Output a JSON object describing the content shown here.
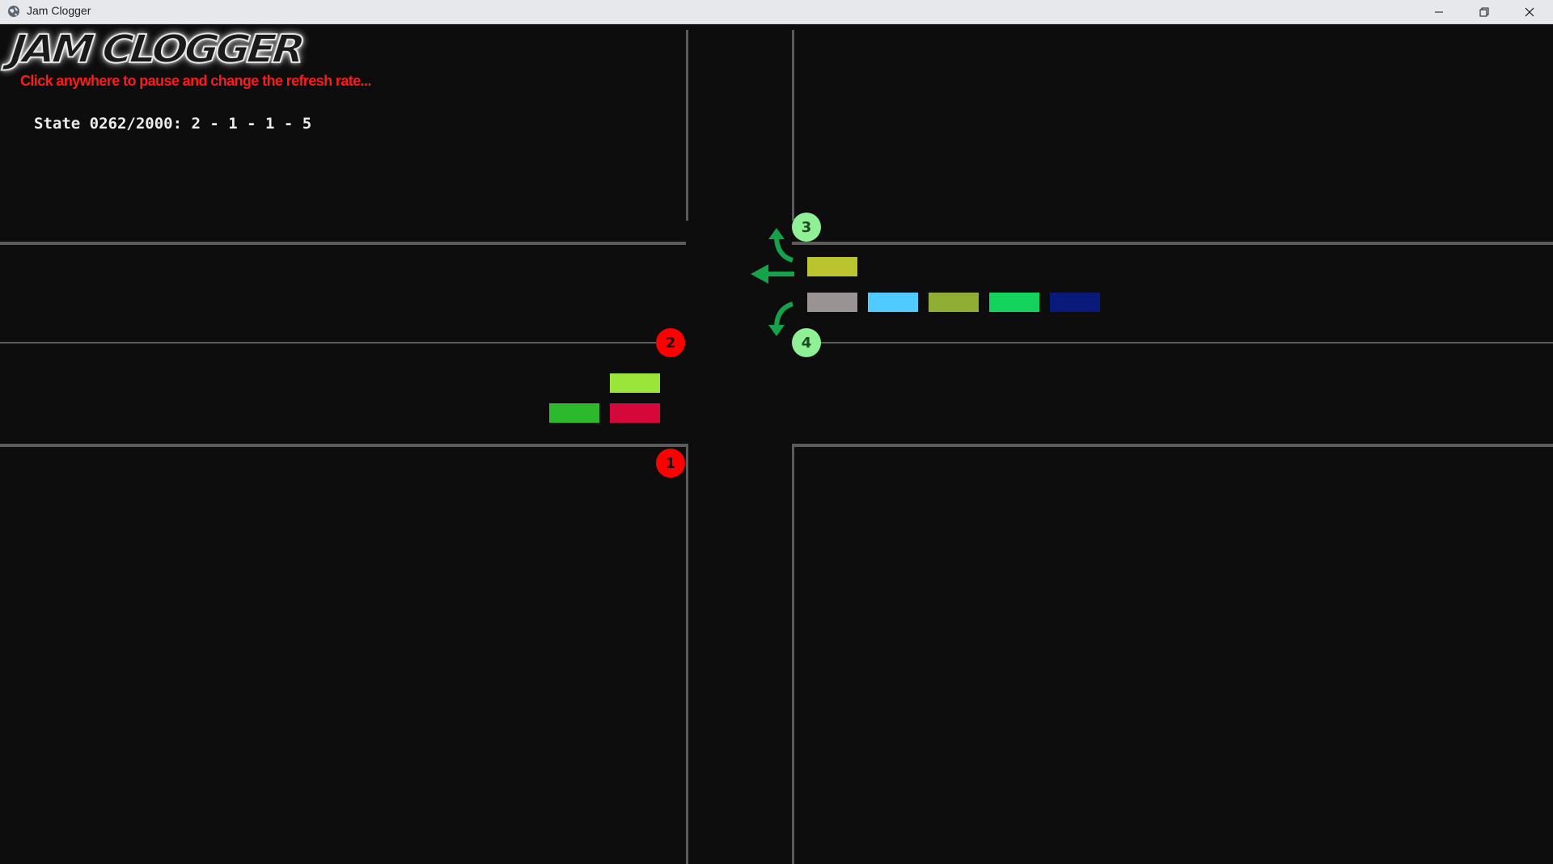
{
  "window": {
    "title": "Jam Clogger",
    "app_icon": "globe-icon",
    "controls": [
      "minimize-icon",
      "restore-icon",
      "close-icon"
    ]
  },
  "game": {
    "logo_text": "JAM CLOGGER",
    "hint": "Click anywhere to pause and change the refresh rate...",
    "state_text": "State 0262/2000: 2 - 1 - 1 - 5",
    "lights": [
      {
        "number": "1",
        "status": "red"
      },
      {
        "number": "2",
        "status": "red"
      },
      {
        "number": "3",
        "status": "green"
      },
      {
        "number": "4",
        "status": "green"
      }
    ],
    "cars": {
      "west_lane_upper": [
        "#9be43a"
      ],
      "west_lane_lower": [
        "#2db82d",
        "#d4083a"
      ],
      "east_lane_upper": [
        "#b9c42e"
      ],
      "east_lane_lower": [
        "#9a9393",
        "#4fcbff",
        "#8fae33",
        "#13d35c",
        "#0a1a7a"
      ]
    },
    "colors": {
      "background": "#0d0d0d",
      "road_line": "#5b5b5b",
      "red_light": "#ff0000",
      "green_light": "#8ff095",
      "arrow": "#15a24a",
      "hint_text": "#ff1a1a"
    }
  }
}
